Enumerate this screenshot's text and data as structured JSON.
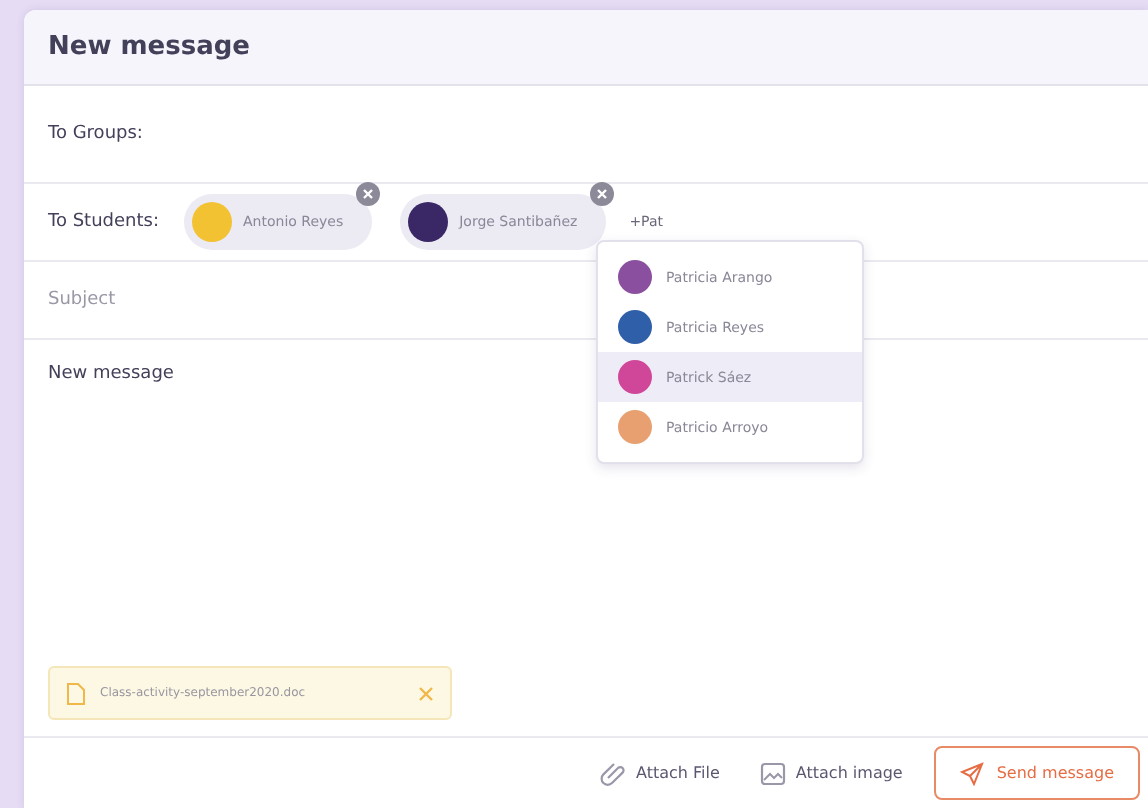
{
  "window": {
    "title": "New message"
  },
  "fields": {
    "groups_label": "To Groups:",
    "students_label": "To Students:",
    "search_value": "+Pat",
    "subject_placeholder": "Subject",
    "body_placeholder": "New message"
  },
  "recipients": [
    {
      "name": "Antonio Reyes",
      "color": "#f2c233"
    },
    {
      "name": "Jorge Santibañez",
      "color": "#3a2766"
    }
  ],
  "suggestions": [
    {
      "name": "Patricia Arango",
      "color": "#8a4f9e",
      "selected": false
    },
    {
      "name": "Patricia Reyes",
      "color": "#2f5fa8",
      "selected": false
    },
    {
      "name": "Patrick Sáez",
      "color": "#d0479a",
      "selected": true
    },
    {
      "name": "Patricio Arroyo",
      "color": "#e8a070",
      "selected": false
    }
  ],
  "attachment": {
    "filename": "Class-activity-september2020.doc"
  },
  "actions": [
    {
      "kind": "file",
      "label": "Attach File"
    },
    {
      "kind": "image",
      "label": "Attach image"
    }
  ],
  "send_button": "Send message"
}
